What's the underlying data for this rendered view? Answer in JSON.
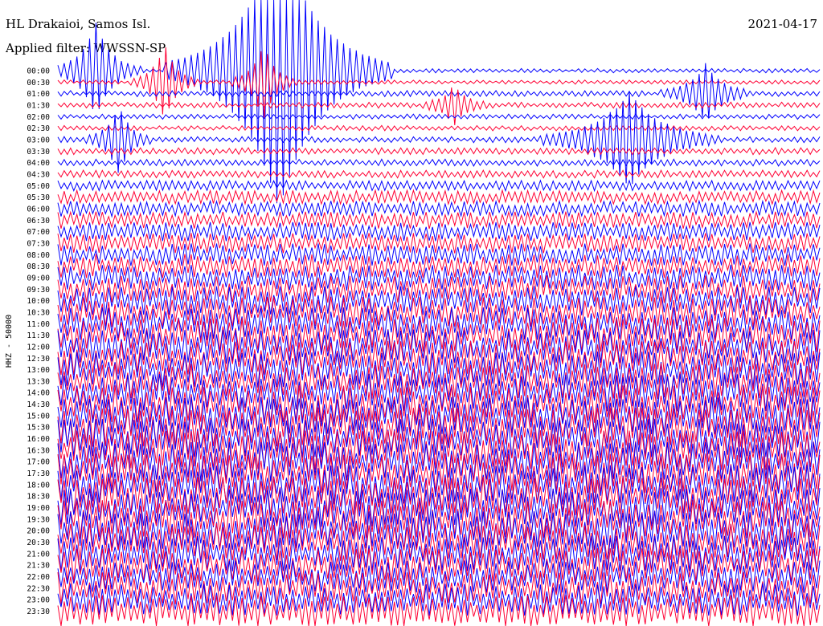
{
  "header": {
    "station": "HL Drakaioi, Samos Isl.",
    "date": "2021-04-17",
    "filter": "Applied filter: WWSSN-SP"
  },
  "chart_data": {
    "type": "line",
    "title": "HL Drakaioi, Samos Isl.",
    "subtitle": "Applied filter: WWSSN-SP",
    "date": "2021-04-17",
    "ylabel": "HHZ - 50000",
    "row_labels": [
      "00:00",
      "00:30",
      "01:00",
      "01:30",
      "02:00",
      "02:30",
      "03:00",
      "03:30",
      "04:00",
      "04:30",
      "05:00",
      "05:30",
      "06:00",
      "06:30",
      "07:00",
      "07:30",
      "08:00",
      "08:30",
      "09:00",
      "09:30",
      "10:00",
      "10:30",
      "11:00",
      "11:30",
      "12:00",
      "12:30",
      "13:00",
      "13:30",
      "14:00",
      "14:30",
      "15:00",
      "15:30",
      "16:00",
      "16:30",
      "17:00",
      "17:30",
      "18:00",
      "18:30",
      "19:00",
      "19:30",
      "20:00",
      "20:30",
      "21:00",
      "21:30",
      "22:00",
      "22:30",
      "23:00",
      "23:30"
    ],
    "series_colors": [
      "#0000ff",
      "#ff0033"
    ],
    "row_amplitude": [
      0.25,
      0.25,
      0.35,
      0.35,
      0.3,
      0.3,
      0.35,
      0.4,
      0.4,
      0.45,
      0.6,
      0.8,
      0.9,
      1.0,
      1.1,
      1.2,
      1.3,
      1.4,
      1.5,
      1.6,
      1.7,
      1.8,
      1.9,
      2.0,
      2.0,
      2.0,
      2.1,
      2.1,
      2.2,
      2.2,
      2.2,
      2.3,
      2.3,
      2.3,
      2.3,
      2.3,
      2.3,
      2.3,
      2.3,
      2.3,
      2.3,
      2.2,
      2.1,
      2.0,
      1.9,
      1.9,
      1.9,
      1.9
    ],
    "events": [
      {
        "row": 0,
        "time_frac": 0.05,
        "strength": 1.0,
        "duration": 0.02
      },
      {
        "row": 1,
        "time_frac": 0.14,
        "strength": 0.8,
        "duration": 0.015
      },
      {
        "row": 1,
        "time_frac": 0.27,
        "strength": 0.8,
        "duration": 0.015
      },
      {
        "row": 2,
        "time_frac": 0.85,
        "strength": 0.6,
        "duration": 0.02
      },
      {
        "row": 3,
        "time_frac": 0.52,
        "strength": 0.4,
        "duration": 0.015
      },
      {
        "row": 6,
        "time_frac": 0.08,
        "strength": 0.7,
        "duration": 0.015
      },
      {
        "row": 6,
        "time_frac": 0.75,
        "strength": 1.0,
        "duration": 0.04
      },
      {
        "row": 0,
        "time_frac": 0.29,
        "strength": 3.0,
        "duration": 0.05
      }
    ]
  }
}
